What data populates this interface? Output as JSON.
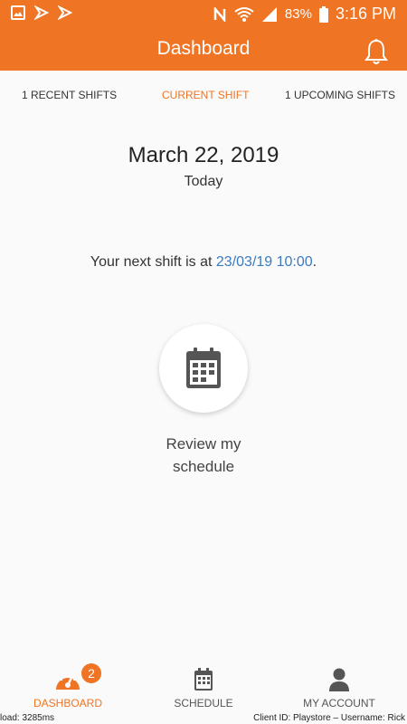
{
  "status_bar": {
    "battery": "83%",
    "time": "3:16 PM"
  },
  "app_bar": {
    "title": "Dashboard"
  },
  "tabs": [
    {
      "label": "1 RECENT SHIFTS",
      "active": false
    },
    {
      "label": "CURRENT SHIFT",
      "active": true
    },
    {
      "label": "1 UPCOMING SHIFTS",
      "active": false
    }
  ],
  "main": {
    "date": "March 22, 2019",
    "day_label": "Today",
    "next_shift_prefix": "Your next shift is at ",
    "next_shift_time": "23/03/19 10:00",
    "next_shift_suffix": ".",
    "review_line1": "Review my",
    "review_line2": "schedule"
  },
  "bottom_nav": {
    "items": [
      {
        "label": "DASHBOARD",
        "icon": "speedometer-icon",
        "active": true,
        "badge": "2"
      },
      {
        "label": "SCHEDULE",
        "icon": "calendar-icon",
        "active": false
      },
      {
        "label": "MY ACCOUNT",
        "icon": "person-icon",
        "active": false
      }
    ]
  },
  "footer": {
    "load": "load: 3285ms",
    "client": "Client ID: Playstore – Username: Rick"
  },
  "colors": {
    "accent": "#ef7424",
    "link": "#3a7bbf"
  }
}
